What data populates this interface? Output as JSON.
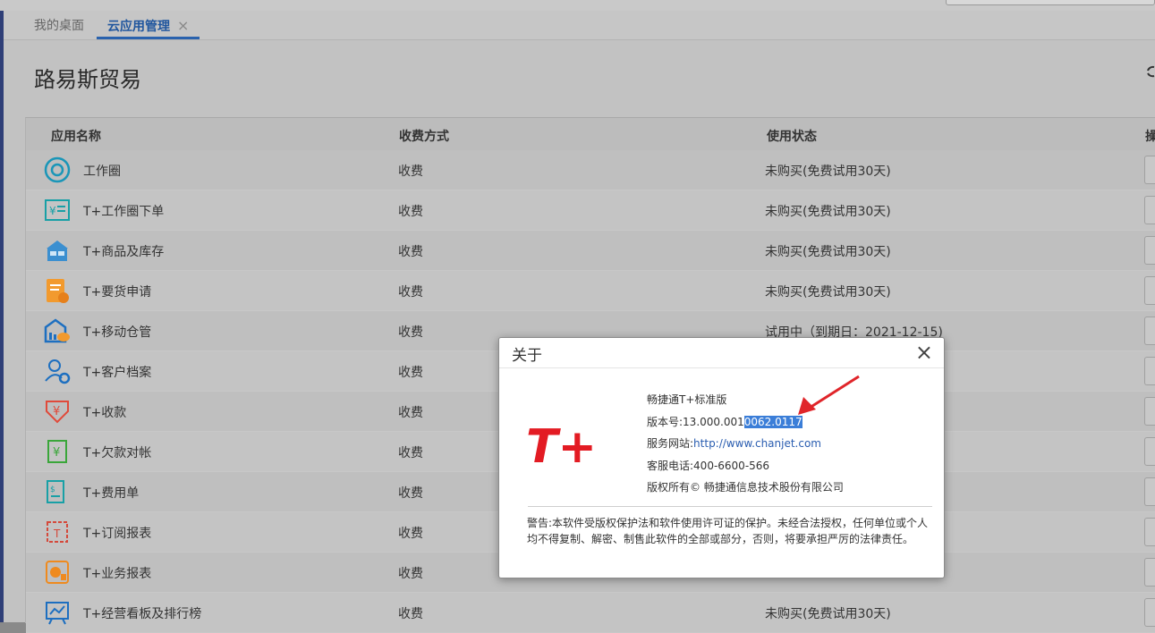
{
  "tabs": [
    {
      "label": "我的桌面",
      "active": false
    },
    {
      "label": "云应用管理",
      "active": true,
      "close": "×"
    }
  ],
  "page": {
    "title": "路易斯贸易"
  },
  "table": {
    "headers": {
      "name": "应用名称",
      "fee": "收费方式",
      "status": "使用状态",
      "op": "操"
    },
    "rows": [
      {
        "icon": "circle-icon",
        "name": "工作圈",
        "fee": "收费",
        "status": "未购买(免费试用30天)"
      },
      {
        "icon": "yen-order-icon",
        "name": "T+工作圈下单",
        "fee": "收费",
        "status": "未购买(免费试用30天)"
      },
      {
        "icon": "store-icon",
        "name": "T+商品及库存",
        "fee": "收费",
        "status": "未购买(免费试用30天)"
      },
      {
        "icon": "request-goods-icon",
        "name": "T+要货申请",
        "fee": "收费",
        "status": "未购买(免费试用30天)"
      },
      {
        "icon": "warehouse-cloud-icon",
        "name": "T+移动仓管",
        "fee": "收费",
        "status": "试用中（到期日：2021-12-15)"
      },
      {
        "icon": "customer-settings-icon",
        "name": "T+客户档案",
        "fee": "收费",
        "status": ""
      },
      {
        "icon": "receipt-yen-icon",
        "name": "T+收款",
        "fee": "收费",
        "status": ""
      },
      {
        "icon": "debt-yen-icon",
        "name": "T+欠款对帐",
        "fee": "收费",
        "status": ""
      },
      {
        "icon": "expense-bill-icon",
        "name": "T+费用单",
        "fee": "收费",
        "status": ""
      },
      {
        "icon": "subscribe-report-icon",
        "name": "T+订阅报表",
        "fee": "收费",
        "status": ""
      },
      {
        "icon": "business-report-icon",
        "name": "T+业务报表",
        "fee": "收费",
        "status": ""
      },
      {
        "icon": "dashboard-board-icon",
        "name": "T+经营看板及排行榜",
        "fee": "收费",
        "status": "未购买(免费试用30天)"
      }
    ]
  },
  "dialog": {
    "title": "关于",
    "close": "×",
    "logo_text": "T+",
    "product": "畅捷通T+标准版",
    "version_prefix": "版本号:13.000.001",
    "version_highlight": "0062.0117",
    "website_label": "服务网站:",
    "website_url": "http://www.chanjet.com",
    "phone": "客服电话:400-6600-566",
    "copyright": "版权所有© 畅捷通信息技术股份有限公司",
    "warning": "警告:本软件受版权保护法和软件使用许可证的保护。未经合法授权，任何单位或个人均不得复制、解密、制售此软件的全部或部分，否则，将要承担严厉的法律责任。"
  },
  "colors": {
    "accent": "#2a62ad",
    "logo_red": "#e31b23",
    "highlight": "#3b7ed8",
    "arrow": "#e0252a"
  }
}
